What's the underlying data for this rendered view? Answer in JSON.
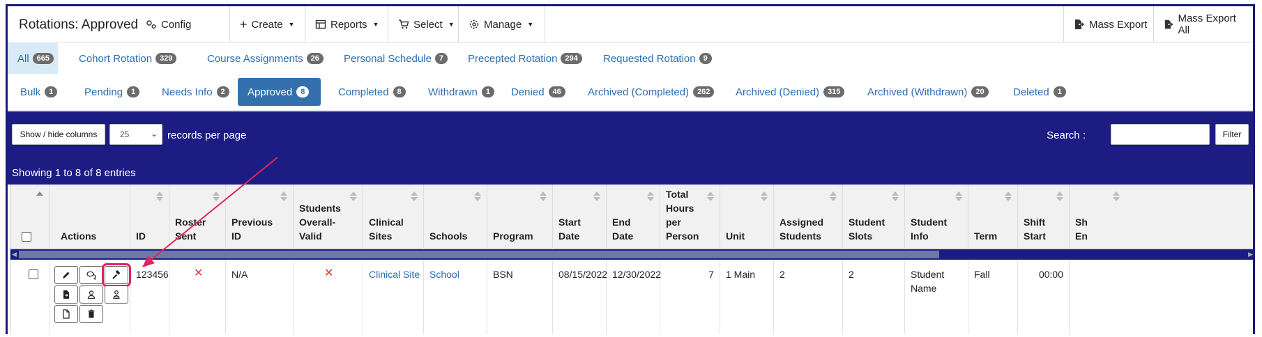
{
  "toolbar": {
    "title": "Rotations: Approved",
    "config_label": "Config",
    "create_label": "Create",
    "reports_label": "Reports",
    "select_label": "Select",
    "manage_label": "Manage",
    "mass_export_label": "Mass Export",
    "mass_export_all_label": "Mass Export All"
  },
  "category_tabs": [
    {
      "label": "All",
      "count": "665"
    },
    {
      "label": "Cohort Rotation",
      "count": "329"
    },
    {
      "label": "Course Assignments",
      "count": "26"
    },
    {
      "label": "Personal Schedule",
      "count": "7"
    },
    {
      "label": "Precepted Rotation",
      "count": "294"
    },
    {
      "label": "Requested Rotation",
      "count": "9"
    }
  ],
  "status_tabs": [
    {
      "label": "Bulk",
      "count": "1"
    },
    {
      "label": "Pending",
      "count": "1"
    },
    {
      "label": "Needs Info",
      "count": "2"
    },
    {
      "label": "Approved",
      "count": "8"
    },
    {
      "label": "Completed",
      "count": "8"
    },
    {
      "label": "Withdrawn",
      "count": "1"
    },
    {
      "label": "Denied",
      "count": "46"
    },
    {
      "label": "Archived (Completed)",
      "count": "262"
    },
    {
      "label": "Archived (Denied)",
      "count": "315"
    },
    {
      "label": "Archived (Withdrawn)",
      "count": "20"
    },
    {
      "label": "Deleted",
      "count": "1"
    }
  ],
  "controls": {
    "show_hide_label": "Show / hide columns",
    "records_per_page_value": "25",
    "records_per_page_label": "records per page",
    "search_label": "Search :",
    "search_value": "",
    "filter_label": "Filter",
    "showing_text": "Showing 1 to 8 of 8 entries"
  },
  "table": {
    "columns": [
      "",
      "Actions",
      "ID",
      "Roster\nSent",
      "Previous\nID",
      "Students\nOverall-\nValid",
      "Clinical\nSites",
      "Schools",
      "Program",
      "Start\nDate",
      "End\nDate",
      "Total\nHours\nper\nPerson",
      "Unit",
      "Assigned\nStudents",
      "Student\nSlots",
      "Student\nInfo",
      "Term",
      "Shift\nStart",
      "Sh\nEn"
    ],
    "row": {
      "id": "123456",
      "roster_sent": "✕",
      "previous_id": "N/A",
      "students_valid": "✕",
      "clinical_site": "Clinical Site",
      "school": "School",
      "program": "BSN",
      "start_date": "08/15/2022",
      "end_date": "12/30/2022",
      "total_hours": "7",
      "unit": "1 Main",
      "assigned_students": "2",
      "student_slots": "2",
      "student_info": "Student\nName",
      "term": "Fall",
      "shift_start": "00:00"
    }
  },
  "icons": {
    "action_icons": [
      "pencil-icon",
      "comments-icon",
      "gavel-icon",
      "file-export-icon",
      "user-icon",
      "user-cert-icon",
      "document-icon",
      "trash-icon"
    ]
  },
  "colors": {
    "navy": "#1c1c82",
    "link": "#2a6db0",
    "active_tab": "#3470ad",
    "highlight": "#e0245e",
    "error_x": "#d33333"
  }
}
